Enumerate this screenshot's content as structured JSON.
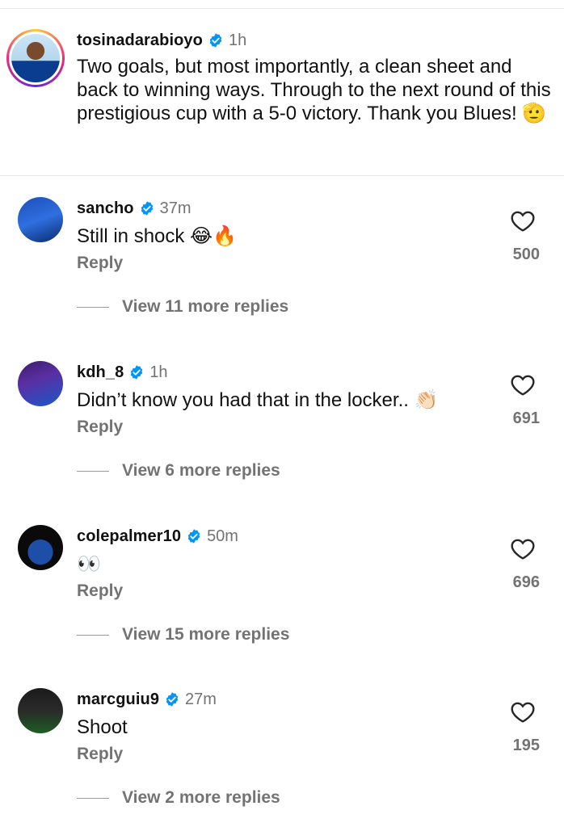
{
  "caption": {
    "username": "tosinadarabioyo",
    "time": "1h",
    "text": "Two goals, but most importantly, a clean sheet and back to winning ways. Through to the next round of this prestigious cup with a 5-0 victory. Thank you Blues! 🫡"
  },
  "comments": [
    {
      "username": "sancho",
      "time": "37m",
      "text": "Still in shock 😂🔥",
      "reply_label": "Reply",
      "likes": "500",
      "view_more": "View 11 more replies"
    },
    {
      "username": "kdh_8",
      "time": "1h",
      "text": "Didn’t know you had that in the locker.. 👏🏻",
      "reply_label": "Reply",
      "likes": "691",
      "view_more": "View 6 more replies"
    },
    {
      "username": "colepalmer10",
      "time": "50m",
      "text": "👀",
      "reply_label": "Reply",
      "likes": "696",
      "view_more": "View 15 more replies"
    },
    {
      "username": "marcguiu9",
      "time": "27m",
      "text": "Shoot",
      "reply_label": "Reply",
      "likes": "195",
      "view_more": "View 2 more replies"
    }
  ],
  "colors": {
    "verified": "#0095f6",
    "muted": "#737373"
  },
  "icons": {
    "verified": "verified-badge-icon",
    "like": "heart-outline-icon"
  }
}
